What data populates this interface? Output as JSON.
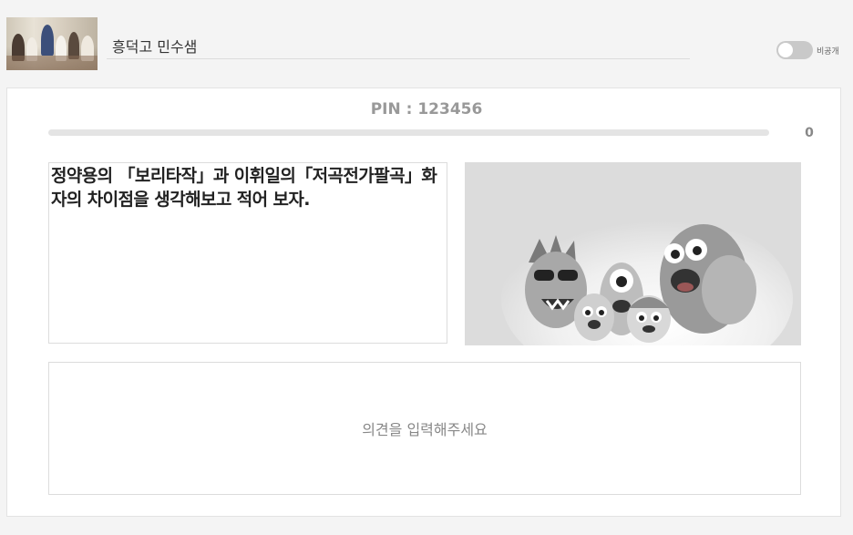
{
  "header": {
    "title": "흥덕고 민수샘",
    "thumbnail_icon": "classroom-photo"
  },
  "visibility_toggle": {
    "label": "비공개",
    "on": false
  },
  "pin": {
    "text": "PIN : 123456"
  },
  "progress": {
    "fraction": 0,
    "count": "0"
  },
  "question": {
    "text": "정약용의 「보리타작」과 이휘일의「저곡전가팔곡」화자의 차이점을 생각해보고 적어 보자."
  },
  "image": {
    "icon": "cartoon-characters-illustration"
  },
  "answer": {
    "placeholder": "의견을 입력해주세요",
    "value": ""
  },
  "colors": {
    "background": "#f4f4f4",
    "card": "#ffffff",
    "pin_text": "#999999",
    "toggle_off": "#c9c9c9"
  }
}
